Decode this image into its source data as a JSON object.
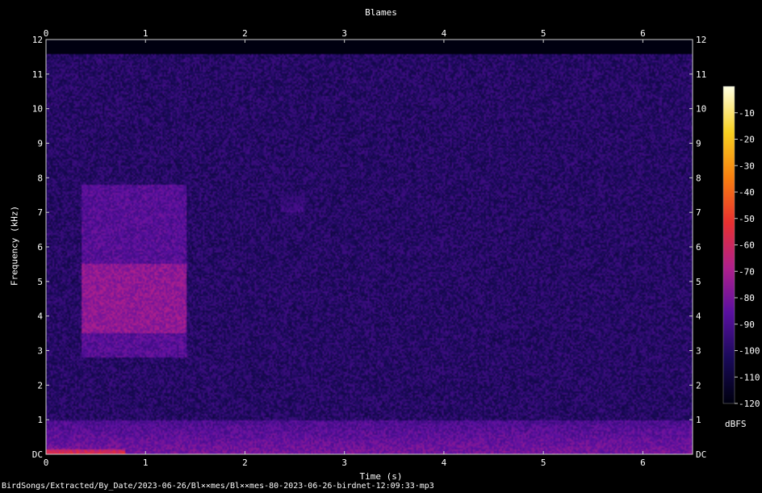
{
  "chart_data": {
    "type": "heatmap",
    "title": "Blames",
    "xlabel": "Time (s)",
    "ylabel": "Frequency (kHz)",
    "x_ticks": [
      "0",
      "1",
      "2",
      "3",
      "4",
      "5",
      "6"
    ],
    "y_ticks": [
      "DC",
      "1",
      "2",
      "3",
      "4",
      "5",
      "6",
      "7",
      "8",
      "9",
      "10",
      "11",
      "12"
    ],
    "xlim": [
      0,
      6.5
    ],
    "ylim": [
      0,
      12
    ],
    "colorbar": {
      "unit": "dBFS",
      "ticks": [
        "-10",
        "-20",
        "-30",
        "-40",
        "-50",
        "-60",
        "-70",
        "-80",
        "-90",
        "-100",
        "-110",
        "-120"
      ],
      "range": [
        -120,
        0
      ],
      "colors": [
        "#000010",
        "#1a0a5a",
        "#5a10a0",
        "#b0208c",
        "#e83030",
        "#f88010",
        "#f8d020",
        "#ffffe0"
      ]
    },
    "background_level_db": -100,
    "notable_regions": [
      {
        "t": [
          0.35,
          1.42
        ],
        "f": [
          2.8,
          7.8
        ],
        "peak_db": -75,
        "peak_f": [
          3.5,
          5.5
        ]
      },
      {
        "t": [
          0.0,
          6.5
        ],
        "f": [
          0.0,
          1.0
        ],
        "peak_db": -80
      },
      {
        "t": [
          0.0,
          0.8
        ],
        "f": [
          0.0,
          0.15
        ],
        "peak_db": -55
      },
      {
        "t": [
          2.35,
          2.6
        ],
        "f": [
          7.0,
          7.6
        ],
        "peak_db": -92
      }
    ]
  },
  "footer": "BirdSongs/Extracted/By_Date/2023-06-26/Bl××mes/Bl××mes-80-2023-06-26-birdnet-12:09:33·mp3"
}
